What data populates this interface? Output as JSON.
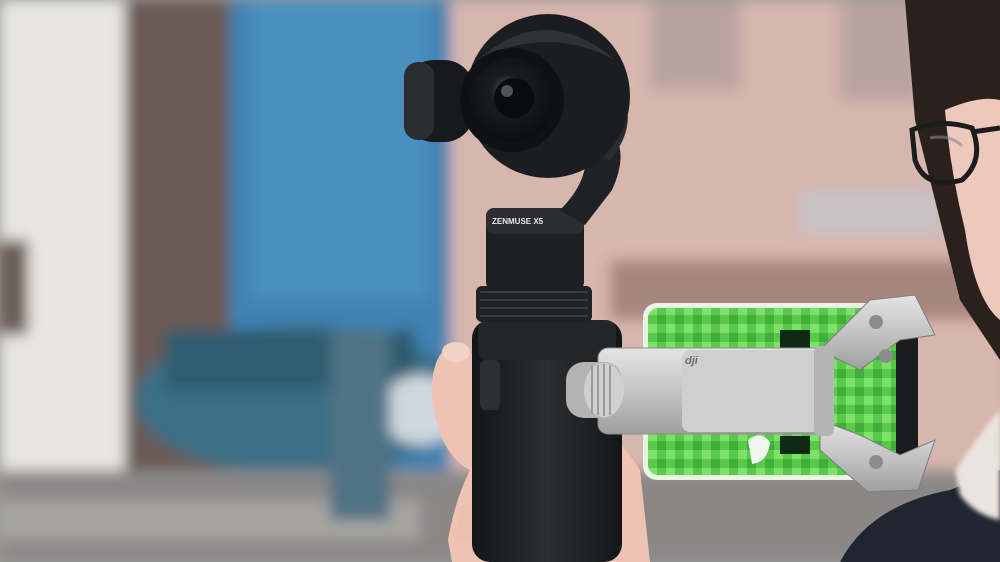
{
  "photo": {
    "gimbal_label": "ZENMUSE X5",
    "mount_logo": "dji",
    "colors": {
      "sky_building": "#d9c2bd",
      "blue_building": "#3a7fb3",
      "white_building": "#e6e6e2",
      "gimbal_black": "#1b1c1e",
      "mount_silver": "#c9c9c9",
      "phone_green": "#5fcf4a",
      "skin": "#eec6b8"
    }
  }
}
